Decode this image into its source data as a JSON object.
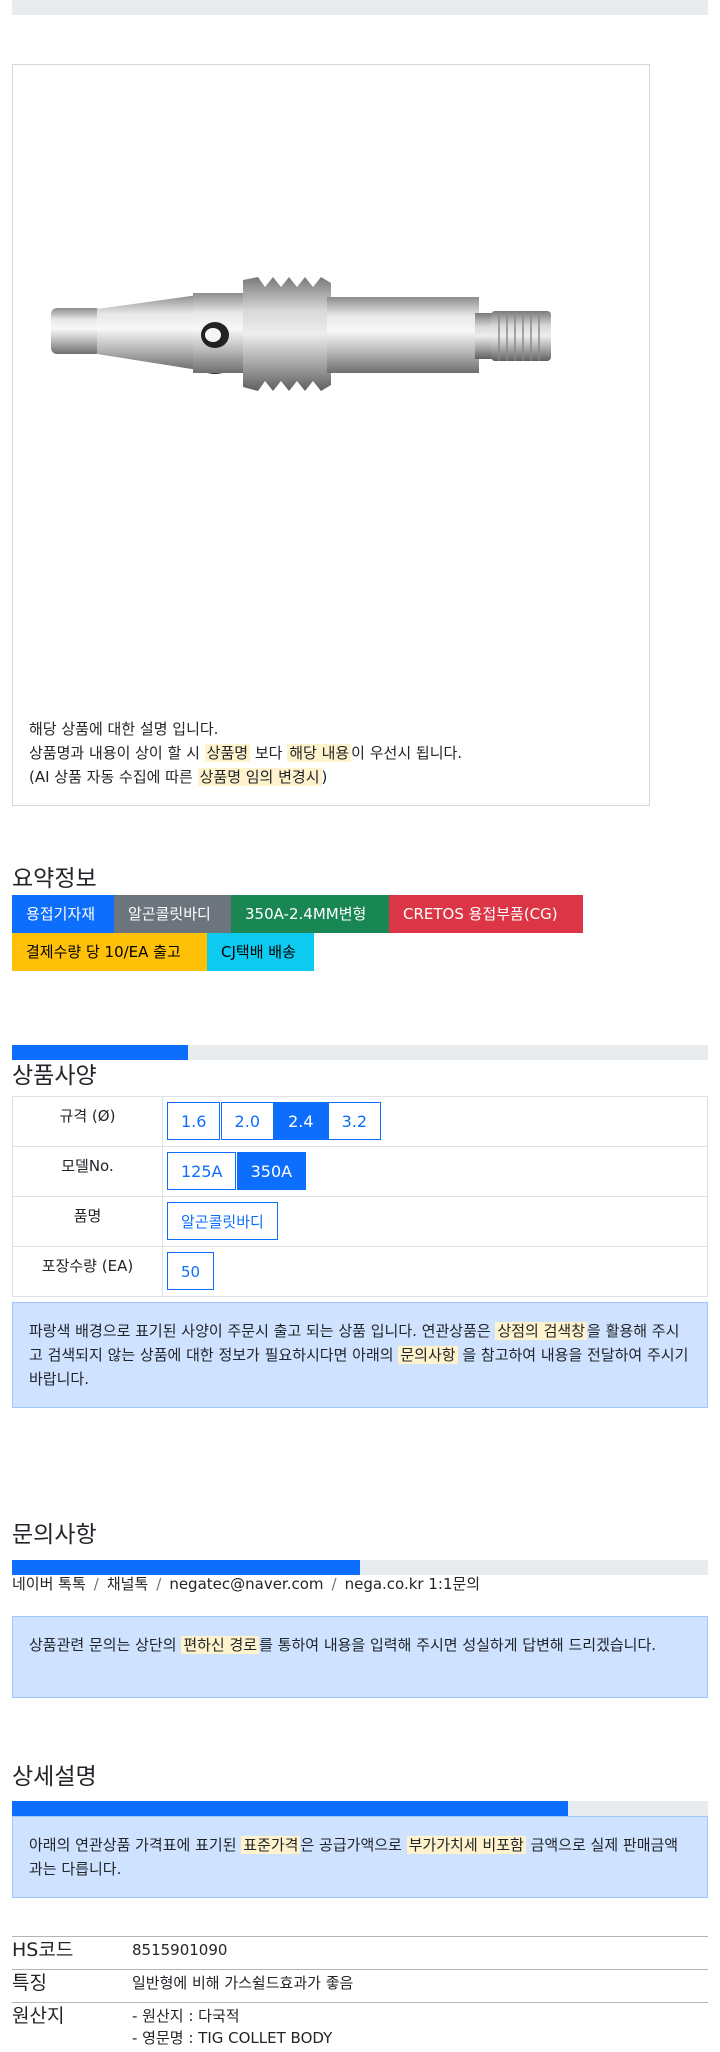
{
  "notice": {
    "line1": "해당 상품에 대한 설명 입니다.",
    "line2_a": "상품명과 내용이 상이 할 시 ",
    "line2_hl1": "상품명",
    "line2_b": " 보다 ",
    "line2_hl2": "해당 내용",
    "line2_c": "이 우선시 됩니다.",
    "line3_a": "(AI 상품 자동 수집에 따른 ",
    "line3_hl": "상품명 임의 변경시",
    "line3_b": ")"
  },
  "summary": {
    "title": "요약정보",
    "badges": [
      {
        "label": "용접기자재",
        "bg": "#0d6efd",
        "fg": "#ffffff"
      },
      {
        "label": "알곤콜릿바디",
        "bg": "#6c757d",
        "fg": "#ffffff"
      },
      {
        "label": "350A-2.4MM변형",
        "bg": "#198754",
        "fg": "#ffffff"
      },
      {
        "label": "CRETOS 용접부품(CG)",
        "bg": "#dc3545",
        "fg": "#ffffff"
      },
      {
        "label": "결제수량 당 10/EA 출고",
        "bg": "#ffc107",
        "fg": "#000000"
      },
      {
        "label": "CJ택배 배송",
        "bg": "#0dcaf0",
        "fg": "#000000"
      }
    ]
  },
  "spec": {
    "title": "상품사양",
    "progress": 0.25,
    "rows": [
      {
        "label": "규격 (Ø)",
        "options": [
          {
            "text": "1.6",
            "selected": false
          },
          {
            "text": "2.0",
            "selected": false
          },
          {
            "text": "2.4",
            "selected": true
          },
          {
            "text": "3.2",
            "selected": false
          }
        ]
      },
      {
        "label": "모델No.",
        "options": [
          {
            "text": "125A",
            "selected": false
          },
          {
            "text": "350A",
            "selected": true
          }
        ]
      },
      {
        "label": "품명",
        "options": [
          {
            "text": "알곤콜릿바디",
            "selected": false
          }
        ]
      },
      {
        "label": "포장수량 (EA)",
        "options": [
          {
            "text": "50",
            "selected": false
          }
        ]
      }
    ],
    "info_a": "파랑색 배경으로 표기된 사양이 주문시 출고 되는 상품 입니다. 연관상품은 ",
    "info_hl1": "상점의 검색창",
    "info_b": "을 활용해 주시고 검색되지 않는 상품에 대한 정보가 필요하시다면 아래의 ",
    "info_hl2": "문의사항",
    "info_c": " 을 참고하여 내용을 전달하여 주시기 바랍니다."
  },
  "inquiry": {
    "title": "문의사항",
    "progress": 0.5,
    "contacts": [
      "네이버 톡톡",
      "채널톡",
      "negatec@naver.com",
      "nega.co.kr 1:1문의"
    ],
    "separator": "/",
    "info_a": "상품관련 문의는 상단의 ",
    "info_hl": "편하신 경로",
    "info_b": "를 통하여 내용을 입력해 주시면 성실하게 답변해 드리겠습니다."
  },
  "detail": {
    "title": "상세설명",
    "progress": 0.8,
    "info_a": "아래의 연관상품 가격표에 표기된 ",
    "info_hl1": "표준가격",
    "info_b": "은 공급가액으로 ",
    "info_hl2": "부가가치세 비포함",
    "info_c": " 금액으로 실제 판매금액과는 다릅니다.",
    "specs": [
      {
        "key": "HS코드",
        "value": "8515901090"
      },
      {
        "key": "특징",
        "value": "일반형에 비해 가스쉴드효과가 좋음"
      },
      {
        "key": "원산지",
        "value": "- 원산지 : 다국적",
        "value2": "- 영문명 : TIG COLLET BODY"
      }
    ]
  }
}
